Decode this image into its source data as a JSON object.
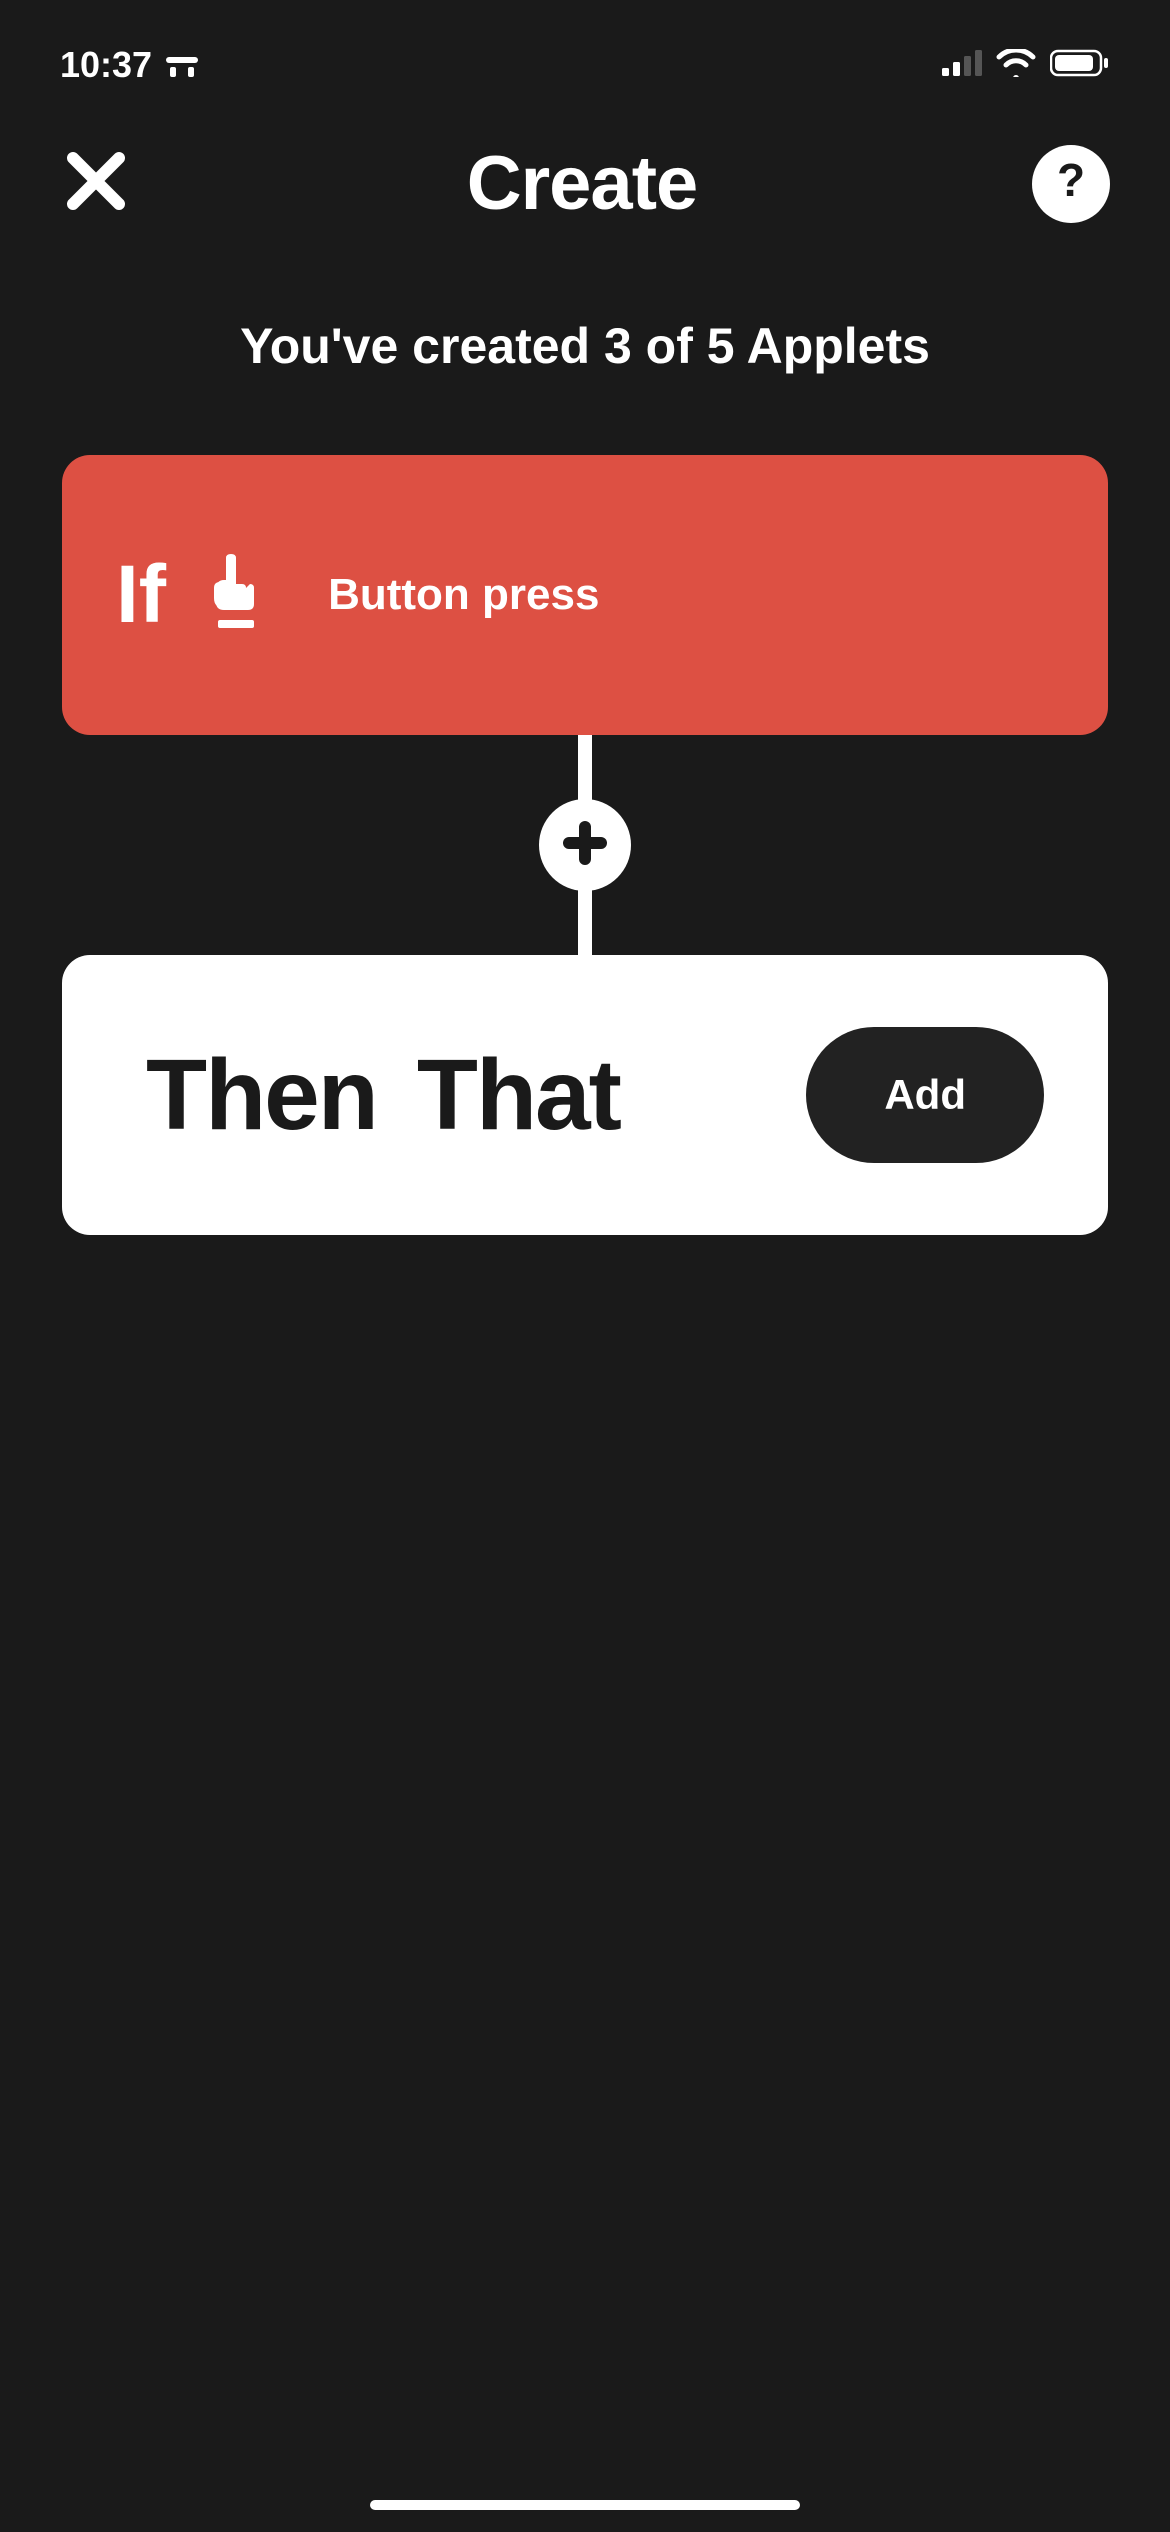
{
  "status_bar": {
    "time": "10:37"
  },
  "nav": {
    "title": "Create",
    "help_label": "?"
  },
  "subtitle": "You've created 3 of 5 Applets",
  "if_card": {
    "label": "If",
    "trigger_name": "Button press"
  },
  "then_card": {
    "word1": "Then",
    "word2": "That",
    "add_label": "Add"
  }
}
